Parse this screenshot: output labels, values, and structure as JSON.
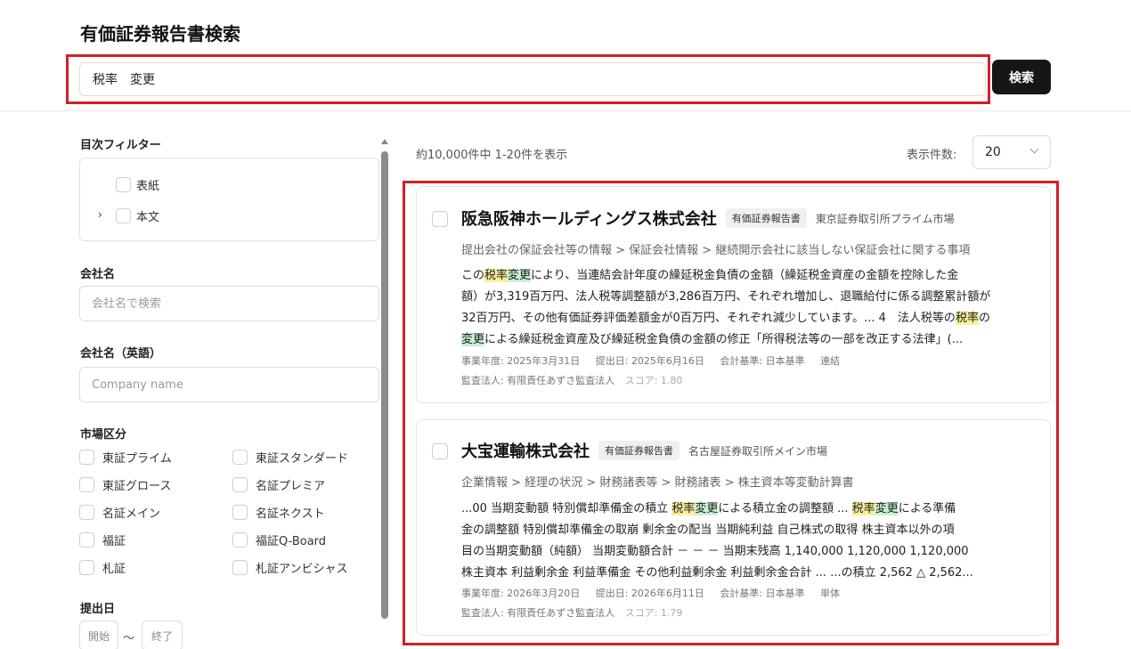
{
  "header": {
    "title": "有価証券報告書検索"
  },
  "search": {
    "value": "税率　変更",
    "button_label": "検索"
  },
  "sidebar": {
    "toc_filter": {
      "label": "目次フィルター",
      "items": [
        "表紙",
        "本文"
      ]
    },
    "company_name": {
      "label": "会社名",
      "placeholder": "会社名で検索"
    },
    "company_name_en": {
      "label": "会社名（英語）",
      "placeholder": "Company name"
    },
    "market": {
      "label": "市場区分",
      "items": [
        "東証プライム",
        "東証スタンダード",
        "東証グロース",
        "名証プレミア",
        "名証メイン",
        "名証ネクスト",
        "福証",
        "福証Q-Board",
        "札証",
        "札証アンビシャス"
      ]
    },
    "filing_date": {
      "label": "提出日",
      "start_placeholder": "開始",
      "separator": "〜",
      "end_placeholder": "終了"
    }
  },
  "results": {
    "count_text": "約10,000件中 1-20件を表示",
    "per_page_label": "表示件数:",
    "per_page_value": "20",
    "cards": [
      {
        "company": "阪急阪神ホールディングス株式会社",
        "doc_type": "有価証券報告書",
        "exchange": "東京証券取引所プライム市場",
        "breadcrumb": "提出会社の保証会社等の情報 > 保証会社情報 > 継続開示会社に該当しない保証会社に関する事項",
        "snippet": [
          [
            {
              "t": "この"
            },
            {
              "t": "税率",
              "h": "y"
            },
            {
              "t": "変更",
              "h": "g"
            },
            {
              "t": "により、当連結会計年度の繰延税金負債の金額（繰延税金資産の金額を控除した金"
            }
          ],
          [
            {
              "t": "額）が3,319百万円、法人税等調整額が3,286百万円、それぞれ増加し、退職給付に係る調整累計額が"
            }
          ],
          [
            {
              "t": "32百万円、その他有価証券評価差額金が0百万円、それぞれ減少しています。... 4　法人税等の"
            },
            {
              "t": "税率",
              "h": "y"
            },
            {
              "t": "の"
            }
          ],
          [
            {
              "t": "変更",
              "h": "g"
            },
            {
              "t": "による繰延税金資産及び繰延税金負債の金額の修正「所得税法等の一部を改正する法律」(..."
            }
          ]
        ],
        "fiscal_year": "事業年度: 2025年3月31日",
        "filing_date": "提出日: 2025年6月16日",
        "accounting_standard": "会計基準: 日本基準",
        "consolidation": "連結",
        "auditor": "監査法人: 有限責任あずさ監査法人",
        "score": "スコア: 1.80"
      },
      {
        "company": "大宝運輸株式会社",
        "doc_type": "有価証券報告書",
        "exchange": "名古屋証券取引所メイン市場",
        "breadcrumb": "企業情報 > 経理の状況 > 財務諸表等 > 財務諸表 > 株主資本等変動計算書",
        "snippet": [
          [
            {
              "t": "...00 当期変動額 特別償却準備金の積立 "
            },
            {
              "t": "税率",
              "h": "y"
            },
            {
              "t": "変更",
              "h": "g"
            },
            {
              "t": "による積立金の調整額 ... "
            },
            {
              "t": "税率",
              "h": "y"
            },
            {
              "t": "変更",
              "h": "g"
            },
            {
              "t": "による準備"
            }
          ],
          [
            {
              "t": "金の調整額 特別償却準備金の取崩 剰余金の配当 当期純利益 自己株式の取得 株主資本以外の項"
            }
          ],
          [
            {
              "t": "目の当期変動額（純額） 当期変動額合計 － － － 当期末残高 1,140,000 1,120,000 1,120,000"
            }
          ],
          [
            {
              "t": "株主資本 利益剰余金 利益準備金 その他利益剰余金 利益剰余金合計 ... ...の積立 2,562 △ 2,562..."
            }
          ]
        ],
        "fiscal_year": "事業年度: 2026年3月20日",
        "filing_date": "提出日: 2026年6月11日",
        "accounting_standard": "会計基準: 日本基準",
        "consolidation": "単体",
        "auditor": "監査法人: 有限責任あずさ監査法人",
        "score": "スコア: 1.79"
      }
    ]
  }
}
